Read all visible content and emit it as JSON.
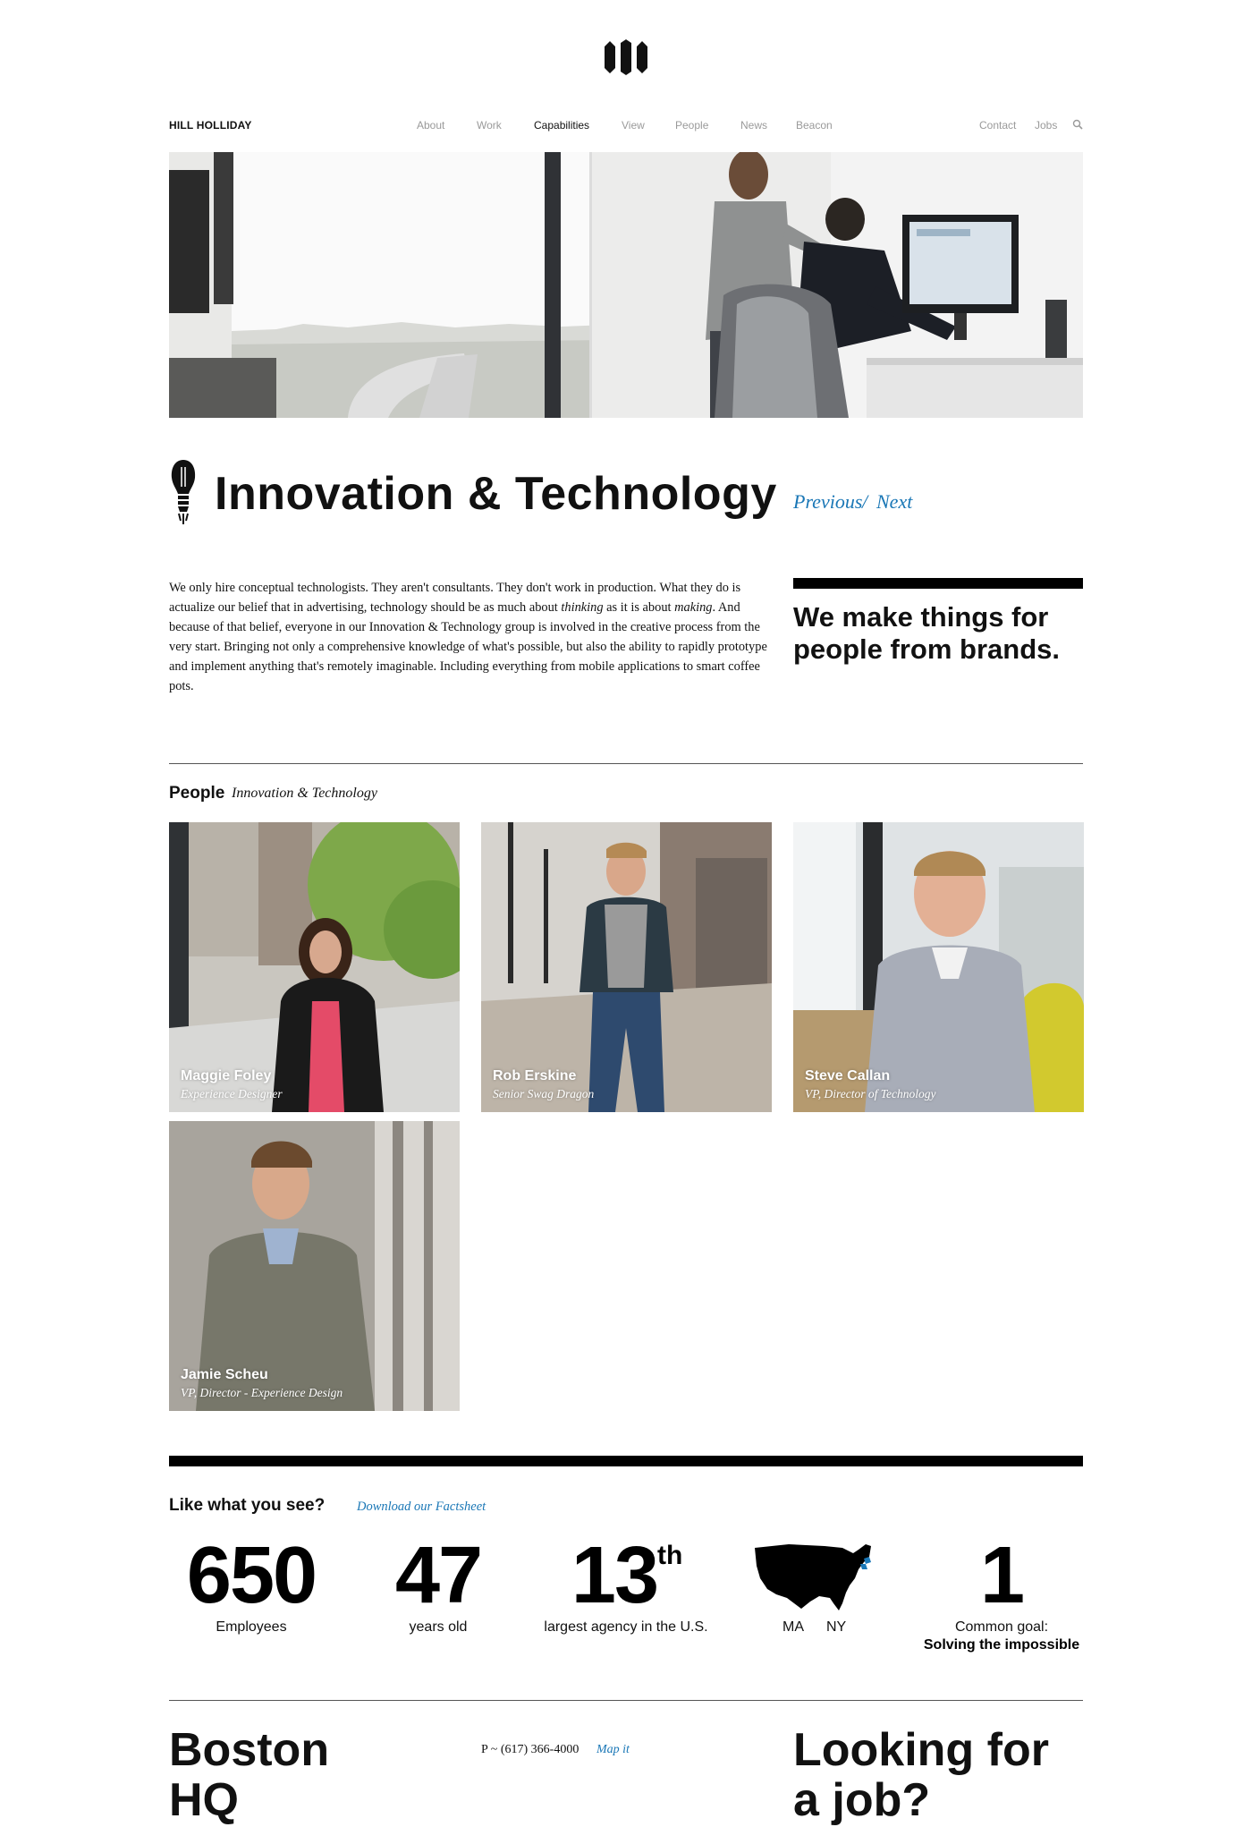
{
  "header": {
    "brand": "HILL HOLLIDAY",
    "nav": [
      "About",
      "Work",
      "Capabilities",
      "View",
      "People",
      "News",
      "Beacon"
    ],
    "active_nav": "Capabilities",
    "utility": [
      "Contact",
      "Jobs"
    ],
    "icons": {
      "logo": "hh-logo-icon",
      "search": "search-icon"
    }
  },
  "page": {
    "title": "Innovation & Technology",
    "previous": "Previous",
    "separator": "/",
    "next": "Next",
    "intro": {
      "p1": "We only hire conceptual technologists. They aren't consultants. They don't work in production. What they do is actualize our belief that in advertising, technology should be as much about ",
      "em1": "thinking",
      "p2": " as it is about ",
      "em2": "making",
      "p3": ". And because of that belief, everyone in our Innovation & Technology group is involved in the creative process from the very start. Bringing not only a comprehensive knowledge of what's possible, but also the ability to rapidly prototype and implement anything that's remotely imaginable. Including everything from mobile applications to smart coffee pots."
    },
    "tagline": "We make things for people from brands."
  },
  "people": {
    "heading": "People",
    "subheading": "Innovation & Technology",
    "members": [
      {
        "name": "Maggie Foley",
        "role": "Experience Designer"
      },
      {
        "name": "Rob Erskine",
        "role": "Senior Swag Dragon"
      },
      {
        "name": "Steve Callan",
        "role": "VP, Director of Technology"
      },
      {
        "name": "Jamie Scheu",
        "role": "VP, Director - Experience Design"
      }
    ]
  },
  "stats": {
    "heading": "Like what you see?",
    "factsheet_link": "Download our Factsheet",
    "items": [
      {
        "value": "650",
        "label": "Employees"
      },
      {
        "value": "47",
        "label": "years old"
      },
      {
        "value": "13",
        "suffix": "th",
        "label": "largest agency in the U.S."
      },
      {
        "labels": [
          "MA",
          "NY"
        ],
        "icon": "us-map-icon"
      },
      {
        "value": "1",
        "label": "Common goal:",
        "label_bold": "Solving the impossible"
      }
    ]
  },
  "footer": {
    "city": "Boston",
    "city_line2": "HQ",
    "phone": "P ~ (617) 366-4000",
    "map_link": "Map it",
    "looking": "Looking for",
    "looking_line2": "a job?"
  },
  "colors": {
    "link": "#1a77b6",
    "nav_inactive": "#9a9a9a",
    "text": "#111111",
    "bar": "#000000"
  }
}
